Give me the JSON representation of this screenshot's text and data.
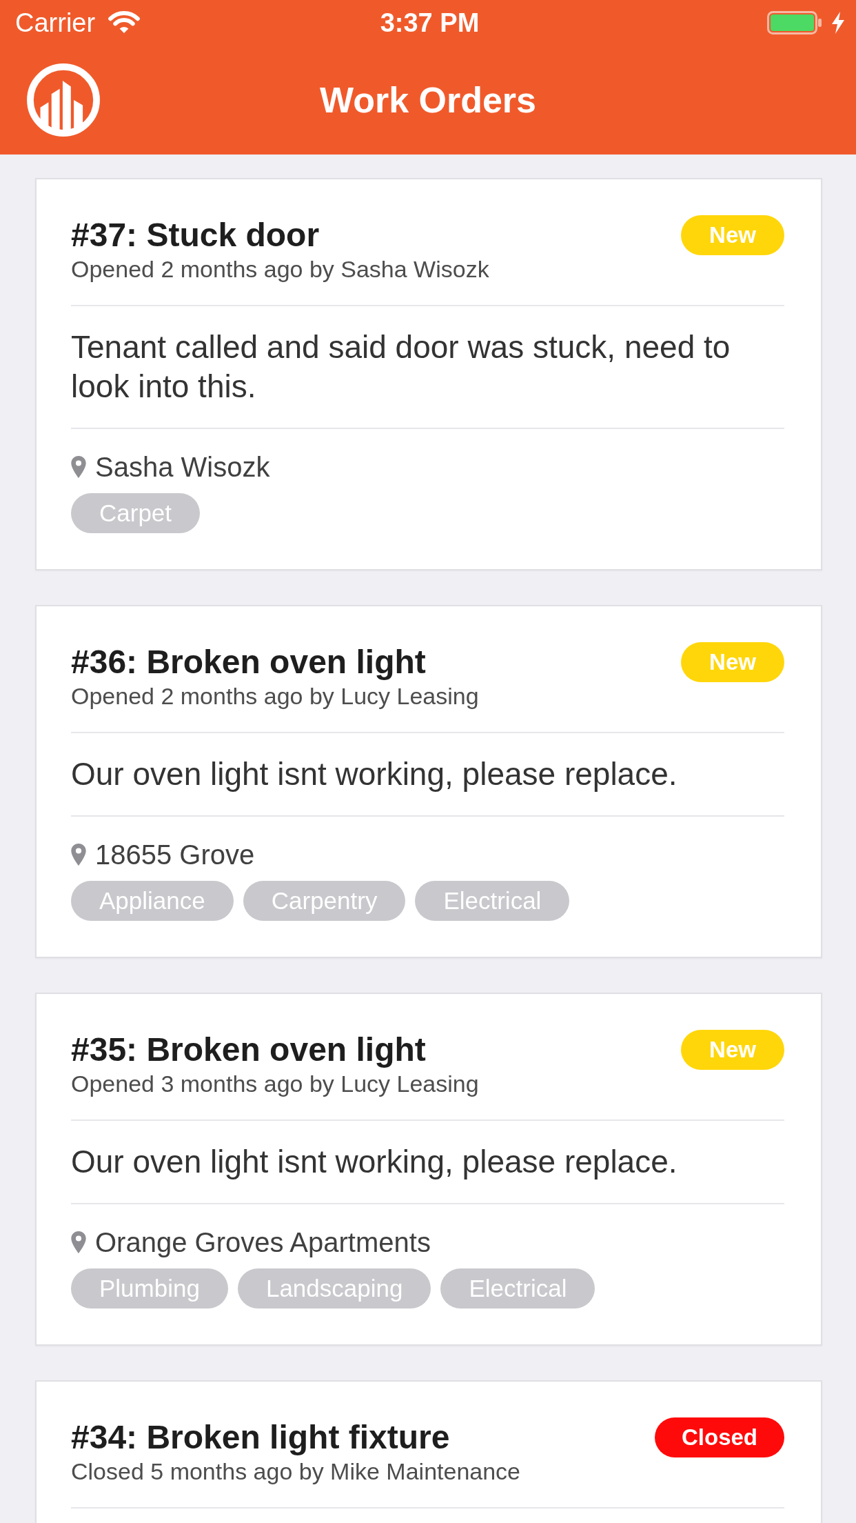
{
  "status_bar": {
    "carrier": "Carrier",
    "time": "3:37 PM"
  },
  "nav_bar": {
    "title": "Work Orders"
  },
  "work_orders": [
    {
      "title": "#37: Stuck door",
      "subtitle": "Opened 2 months ago by Sasha Wisozk",
      "status": {
        "label": "New",
        "color": "#ffd60a"
      },
      "description": "Tenant called and said door was stuck, need to look into this.",
      "location": "Sasha Wisozk",
      "tags": [
        "Carpet"
      ]
    },
    {
      "title": "#36: Broken oven light",
      "subtitle": "Opened 2 months ago by Lucy Leasing",
      "status": {
        "label": "New",
        "color": "#ffd60a"
      },
      "description": "Our oven light isnt working, please replace.",
      "location": "18655 Grove",
      "tags": [
        "Appliance",
        "Carpentry",
        "Electrical"
      ]
    },
    {
      "title": "#35: Broken oven light",
      "subtitle": "Opened 3 months ago by Lucy Leasing",
      "status": {
        "label": "New",
        "color": "#ffd60a"
      },
      "description": "Our oven light isnt working, please replace.",
      "location": "Orange Groves Apartments",
      "tags": [
        "Plumbing",
        "Landscaping",
        "Electrical"
      ]
    },
    {
      "title": "#34: Broken light fixture",
      "subtitle": "Closed 5 months ago by Mike Maintenance",
      "status": {
        "label": "Closed",
        "color": "#ff0a0a"
      }
    }
  ]
}
